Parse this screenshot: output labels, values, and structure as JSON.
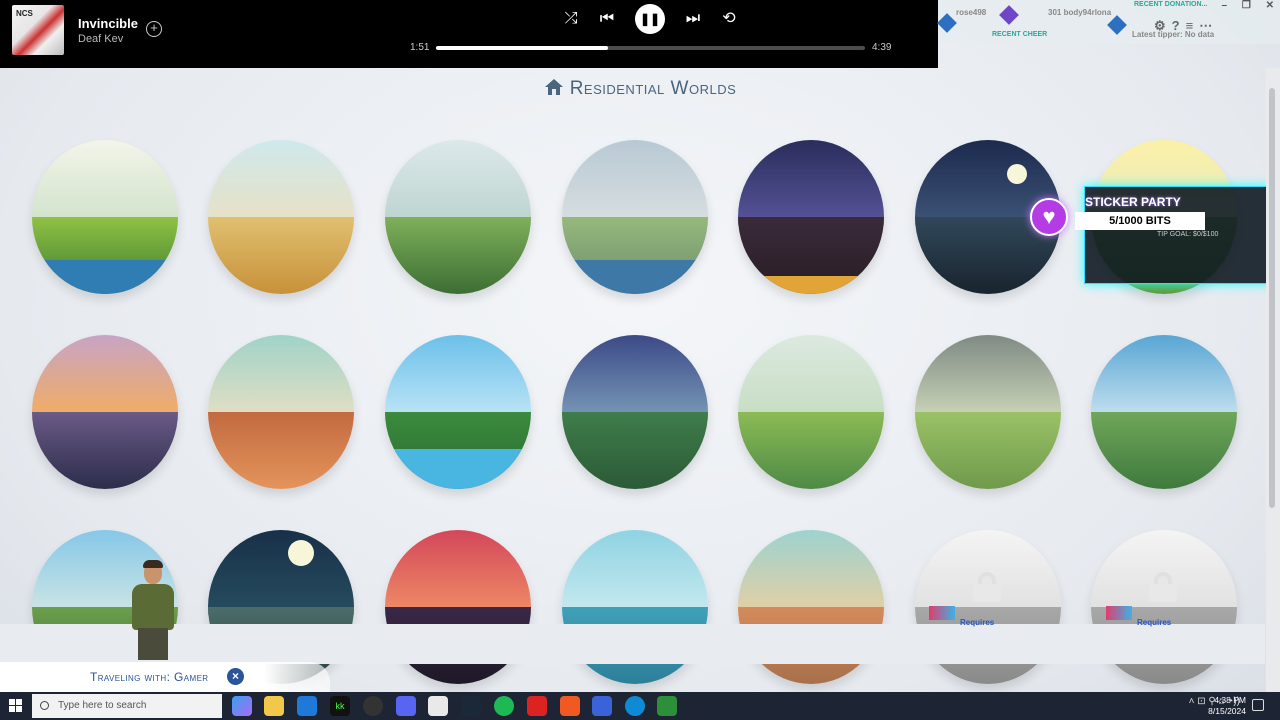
{
  "player": {
    "art_label": "NCS",
    "track": "Invincible",
    "artist": "Deaf Kev",
    "elapsed": "1:51",
    "duration": "4:39",
    "progress": 0.4,
    "icons": [
      "add-icon",
      "shuffle-icon",
      "previous-icon",
      "pause-icon",
      "next-icon",
      "repeat-icon"
    ]
  },
  "overlay": {
    "recent_donation": "RECENT DONATION...",
    "recent_cheer": "RECENT CHEER",
    "name1": "rose498",
    "name2": "301 body94rlona",
    "name3": "Latest tipper: No data"
  },
  "heading": "Residential Worlds",
  "worlds": {
    "requires_1": "Requires",
    "requires_2": "Requires"
  },
  "sticker": {
    "title": "STICKER PARTY",
    "bits": "5/1000 BITS",
    "goal": "TIP GOAL: $0/$100"
  },
  "travel": {
    "label": "Traveling with: Gamer",
    "close": "×"
  },
  "taskbar": {
    "search_placeholder": "Type here to search",
    "time": "4:38 PM",
    "date": "8/15/2024"
  }
}
